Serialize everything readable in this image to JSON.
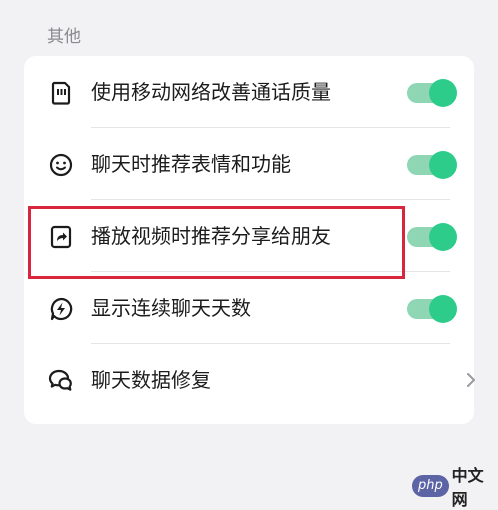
{
  "section": {
    "title": "其他"
  },
  "settings": [
    {
      "label": "使用移动网络改善通话质量",
      "icon": "sim-card-icon",
      "control": "toggle",
      "on": true
    },
    {
      "label": "聊天时推荐表情和功能",
      "icon": "smiley-face-icon",
      "control": "toggle",
      "on": true
    },
    {
      "label": "播放视频时推荐分享给朋友",
      "icon": "share-video-icon",
      "control": "toggle",
      "on": true
    },
    {
      "label": "显示连续聊天天数",
      "icon": "lightning-bolt-icon",
      "control": "toggle",
      "on": true
    },
    {
      "label": "聊天数据修复",
      "icon": "chat-bubbles-icon",
      "control": "chevron"
    }
  ],
  "colors": {
    "toggle_on": "#2ecc8a",
    "toggle_track": "#8fd7b4",
    "highlight": "#d7263d"
  },
  "watermark": {
    "logo": "php",
    "text": "中文网"
  }
}
